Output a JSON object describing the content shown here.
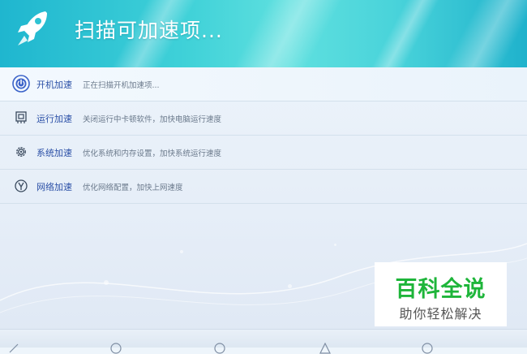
{
  "header": {
    "title": "扫描可加速项...",
    "icon": "rocket-icon"
  },
  "items": [
    {
      "name": "开机加速",
      "desc": "正在扫描开机加速项...",
      "icon": "power-icon",
      "active": true
    },
    {
      "name": "运行加速",
      "desc": "关闭运行中卡顿软件，加快电脑运行速度",
      "icon": "chip-icon",
      "active": false
    },
    {
      "name": "系统加速",
      "desc": "优化系统和内存设置，加快系统运行速度",
      "icon": "gear-icon",
      "active": false
    },
    {
      "name": "网络加速",
      "desc": "优化网络配置，加快上网速度",
      "icon": "network-icon",
      "active": false
    }
  ],
  "watermark": {
    "main": "百科全说",
    "sub": "助你轻松解决"
  },
  "colors": {
    "accent": "#2a4fa6",
    "header": "#3fd1d8",
    "watermark_green": "#1eb53a"
  }
}
